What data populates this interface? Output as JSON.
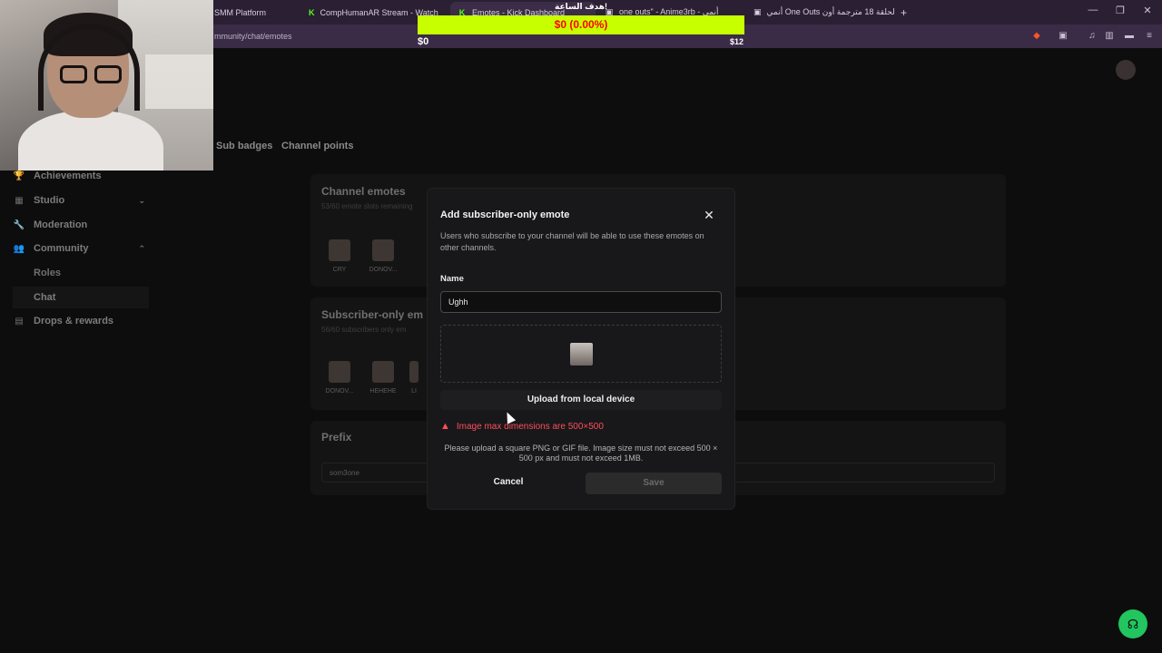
{
  "browser": {
    "tabs": [
      {
        "label": "SMM Platform",
        "favicon": ""
      },
      {
        "label": "CompHumanAR Stream - Watch Live",
        "favicon": "K"
      },
      {
        "label": "Emotes - Kick Dashboard",
        "favicon": "K"
      },
      {
        "label": "one outs\" - Anime3rb - أنمي",
        "favicon": "▣"
      },
      {
        "label": "أنمي One Outs الحلقة 18 مترجمة أون",
        "favicon": "▣"
      }
    ],
    "new_tab_symbol": "+",
    "url": "mmunity/chat/emotes",
    "window_controls": {
      "minimize": "—",
      "restore": "❐",
      "close": "✕"
    }
  },
  "stream_goal": {
    "title": "هدف الساعة!",
    "progress_text": "$0 (0.00%)",
    "progress_fraction": 0.0,
    "min": "$0",
    "max": "$12",
    "bar_color": "#c7ff00",
    "text_color": "#ff0000"
  },
  "dashboard": {
    "sub_tabs": [
      "Sub badges",
      "Channel points"
    ],
    "sidebar": {
      "items": [
        {
          "label": "Achievements",
          "icon": "trophy-icon",
          "glyph": "🏆"
        },
        {
          "label": "Studio",
          "icon": "studio-icon",
          "glyph": "▦",
          "chevron": "⌄"
        },
        {
          "label": "Moderation",
          "icon": "wrench-icon",
          "glyph": "🔧"
        },
        {
          "label": "Community",
          "icon": "users-icon",
          "glyph": "👥",
          "chevron": "⌃"
        },
        {
          "label": "Drops & rewards",
          "icon": "gift-icon",
          "glyph": "▤"
        }
      ],
      "community_subitems": [
        "Roles",
        "Chat"
      ]
    },
    "channel_emotes": {
      "title": "Channel emotes",
      "subtitle": "53/60 emote slots remaining",
      "emotes": [
        "CRY",
        "DONOV..."
      ]
    },
    "subscriber_emotes": {
      "title": "Subscriber-only em",
      "subtitle": "56/60 subscribers only em",
      "emotes": [
        "DONOV...",
        "HEHEHE",
        "LI"
      ]
    },
    "prefix": {
      "title": "Prefix",
      "value": "som3one"
    }
  },
  "modal": {
    "title": "Add subscriber-only emote",
    "description": "Users who subscribe to your channel will be able to use these emotes on other channels.",
    "name_label": "Name",
    "name_value": "Ughh",
    "upload_label": "Upload from local device",
    "error_text": "Image max dimensions are 500×500",
    "help_text": "Please upload a square PNG or GIF file. Image size must not exceed 500 × 500 px and must not exceed 1MB.",
    "cancel_label": "Cancel",
    "save_label": "Save",
    "close_symbol": "✕",
    "error_color": "#ff4d5e"
  }
}
